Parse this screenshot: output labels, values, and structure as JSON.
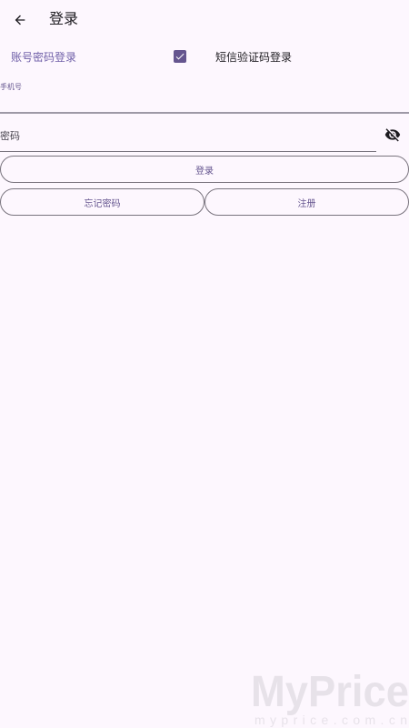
{
  "header": {
    "title": "登录"
  },
  "login_mode": {
    "account_password_label": "账号密码登录",
    "sms_code_label": "短信验证码登录",
    "sms_checked": true
  },
  "form": {
    "phone_label": "手机号",
    "password_label": "密码"
  },
  "buttons": {
    "login": "登录",
    "forgot_password": "忘记密码",
    "register": "注册"
  },
  "watermark": {
    "text": "MyPrice",
    "subtext": "myprice.com.cn"
  },
  "colors": {
    "background": "#fdf7fe",
    "accent": "#65558f",
    "outline": "#79747e"
  }
}
